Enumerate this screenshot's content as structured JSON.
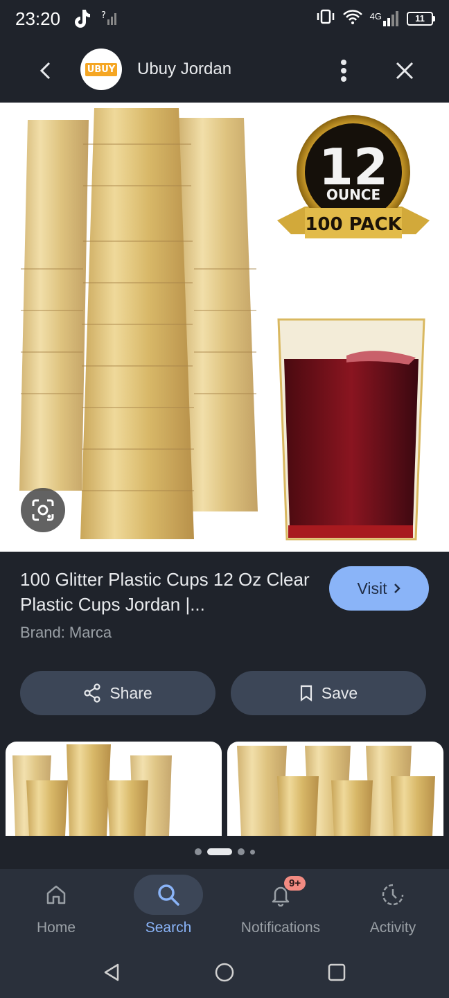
{
  "status_bar": {
    "time": "23:20",
    "network": "4G",
    "battery": "11",
    "icons": [
      "tiktok-icon",
      "signal-unknown-icon",
      "vibrate-icon",
      "wifi-icon",
      "signal-icon",
      "battery-icon"
    ]
  },
  "header": {
    "site_name": "Ubuy Jordan",
    "logo_text": "UBUY",
    "icons": [
      "back-icon",
      "more-vert-icon",
      "close-icon"
    ]
  },
  "product": {
    "badge_top": "12",
    "badge_mid": "OUNCE",
    "badge_ribbon": "100 PACK",
    "title": "100 Glitter Plastic Cups 12 Oz Clear Plastic Cups Jordan |...",
    "brand": "Brand: Marca",
    "visit_label": "Visit",
    "share_label": "Share",
    "save_label": "Save"
  },
  "pager": {
    "count": 4,
    "active": 1
  },
  "bottom_nav": {
    "items": [
      {
        "label": "Home",
        "icon": "home-icon"
      },
      {
        "label": "Search",
        "icon": "search-icon"
      },
      {
        "label": "Notifications",
        "icon": "bell-icon",
        "badge": "9+"
      },
      {
        "label": "Activity",
        "icon": "activity-icon"
      }
    ],
    "active_index": 1
  },
  "system_nav": [
    "back-triangle-icon",
    "home-circle-icon",
    "recents-square-icon"
  ],
  "colors": {
    "background": "#1f232b",
    "accent": "#8ab4f8",
    "button": "#3c4657",
    "badge": "#f28b82",
    "gold": "#d9b860",
    "drink": "#6a0f16"
  }
}
